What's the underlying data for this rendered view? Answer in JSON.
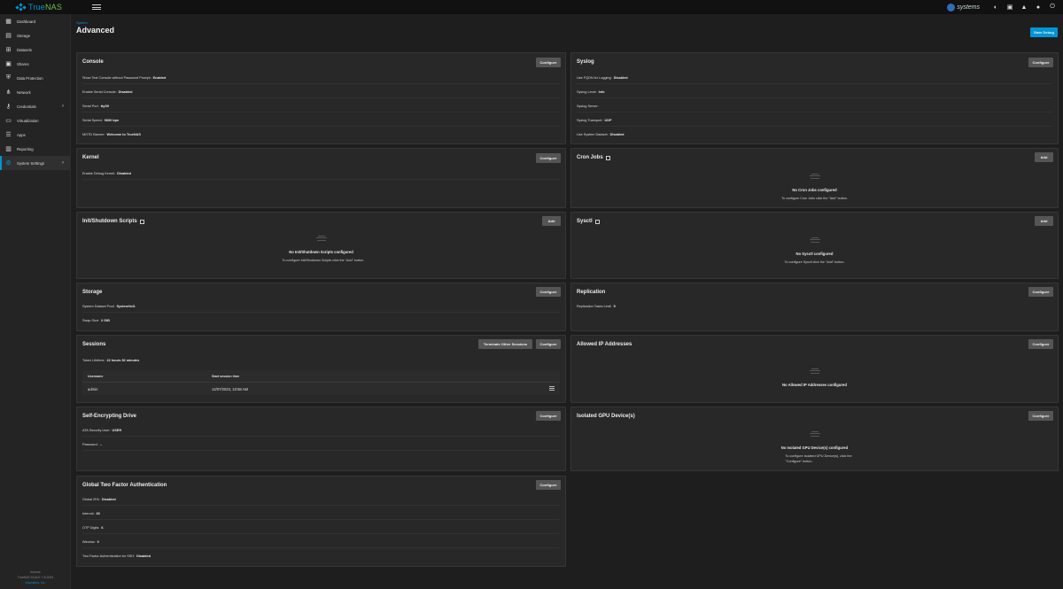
{
  "app": {
    "logo_name": "True",
    "logo_name_accent": "NAS",
    "ix_label": "systems",
    "icons": [
      "hamburger-menu-icon",
      "ix-systems-logo",
      "truecommand-icon",
      "clipboard-icon",
      "bell-icon",
      "account-icon",
      "power-icon"
    ],
    "brand_color": "#0095d5"
  },
  "sidebar": {
    "items": [
      {
        "label": "Dashboard",
        "icon": "dashboard-icon",
        "glyph": "▦"
      },
      {
        "label": "Storage",
        "icon": "storage-icon",
        "glyph": "▤"
      },
      {
        "label": "Datasets",
        "icon": "datasets-icon",
        "glyph": "⊞"
      },
      {
        "label": "Shares",
        "icon": "shares-icon",
        "glyph": "▣"
      },
      {
        "label": "Data Protection",
        "icon": "shield-icon",
        "glyph": "⛨"
      },
      {
        "label": "Network",
        "icon": "network-icon",
        "glyph": "⋔"
      },
      {
        "label": "Credentials",
        "icon": "key-icon",
        "glyph": "⚷"
      },
      {
        "label": "Virtualization",
        "icon": "monitor-icon",
        "glyph": "▭"
      },
      {
        "label": "Apps",
        "icon": "apps-icon",
        "glyph": "☰"
      },
      {
        "label": "Reporting",
        "icon": "reporting-icon",
        "glyph": "▥"
      },
      {
        "label": "System Settings",
        "icon": "gear-icon",
        "glyph": "⚙"
      }
    ],
    "footer_host": "truenas",
    "footer_version": "TrueNAS SCALE 7-5-2023",
    "footer_copyright": "iXsystems, Inc."
  },
  "header": {
    "breadcrumb": "System",
    "title": "Advanced",
    "save_debug_label": "Save Debug"
  },
  "buttons": {
    "configure": "Configure",
    "add": "Add",
    "terminate": "Terminate Other Sessions"
  },
  "console": {
    "title": "Console",
    "rows": [
      {
        "label": "Show Text Console without Password Prompt:",
        "value": "Enabled"
      },
      {
        "label": "Enable Serial Console:",
        "value": "Disabled"
      },
      {
        "label": "Serial Port:",
        "value": "ttyS0"
      },
      {
        "label": "Serial Speed:",
        "value": "9600 bps"
      },
      {
        "label": "MOTD Banner:",
        "value": "Welcome to TrueNAS"
      }
    ]
  },
  "syslog": {
    "title": "Syslog",
    "rows": [
      {
        "label": "Use FQDN for Logging:",
        "value": "Disabled"
      },
      {
        "label": "Syslog Level:",
        "value": "Info"
      },
      {
        "label": "Syslog Server:",
        "value": ""
      },
      {
        "label": "Syslog Transport:",
        "value": "UDP"
      },
      {
        "label": "Use System Dataset:",
        "value": "Disabled"
      }
    ]
  },
  "kernel": {
    "title": "Kernel",
    "rows": [
      {
        "label": "Enable Debug Kernel:",
        "value": "Disabled"
      }
    ]
  },
  "cron": {
    "title": "Cron Jobs",
    "empty_title": "No Cron Jobs configured",
    "empty_sub": "To configure Cron Jobs click the \"Add\" button."
  },
  "init": {
    "title": "Init/Shutdown Scripts",
    "empty_title": "No Init/Shutdown Scripts configured",
    "empty_sub": "To configure Init/Shutdown Scripts click the \"Add\" button."
  },
  "sysctl": {
    "title": "Sysctl",
    "empty_title": "No Sysctl configured",
    "empty_sub": "To configure Sysctl click the \"Add\" button."
  },
  "storage": {
    "title": "Storage",
    "rows": [
      {
        "label": "System Dataset Pool:",
        "value": "SystemVol1"
      },
      {
        "label": "Swap Size:",
        "value": "2 GiB"
      }
    ]
  },
  "replication": {
    "title": "Replication",
    "rows": [
      {
        "label": "Replication Tasks Limit:",
        "value": "5"
      }
    ]
  },
  "sessions": {
    "title": "Sessions",
    "token_label": "Token Lifetime:",
    "token_value": "22 hours 30 minutes",
    "col_username": "Username",
    "col_start": "Start session time",
    "row_username": "admin",
    "row_start": "12/07/2023, 10:58 AM"
  },
  "allowed_ip": {
    "title": "Allowed IP Addresses",
    "empty_title": "No Allowed IP Addresses configured"
  },
  "sed": {
    "title": "Self-Encrypting Drive",
    "rows": [
      {
        "label": "ATA Security User:",
        "value": "USER"
      },
      {
        "label": "Password:",
        "value": "–"
      }
    ]
  },
  "gpu": {
    "title": "Isolated GPU Device(s)",
    "empty_title": "No Isolated GPU Device(s) configured",
    "empty_sub": "To configure Isolated GPU Device(s), click the \"Configure\" button."
  },
  "twofa": {
    "title": "Global Two Factor Authentication",
    "rows": [
      {
        "label": "Global 2FA:",
        "value": "Disabled"
      },
      {
        "label": "Interval:",
        "value": "30"
      },
      {
        "label": "OTP Digits:",
        "value": "6"
      },
      {
        "label": "Window:",
        "value": "0"
      },
      {
        "label": "Two Factor Authentication for SSH:",
        "value": "Disabled"
      }
    ]
  }
}
